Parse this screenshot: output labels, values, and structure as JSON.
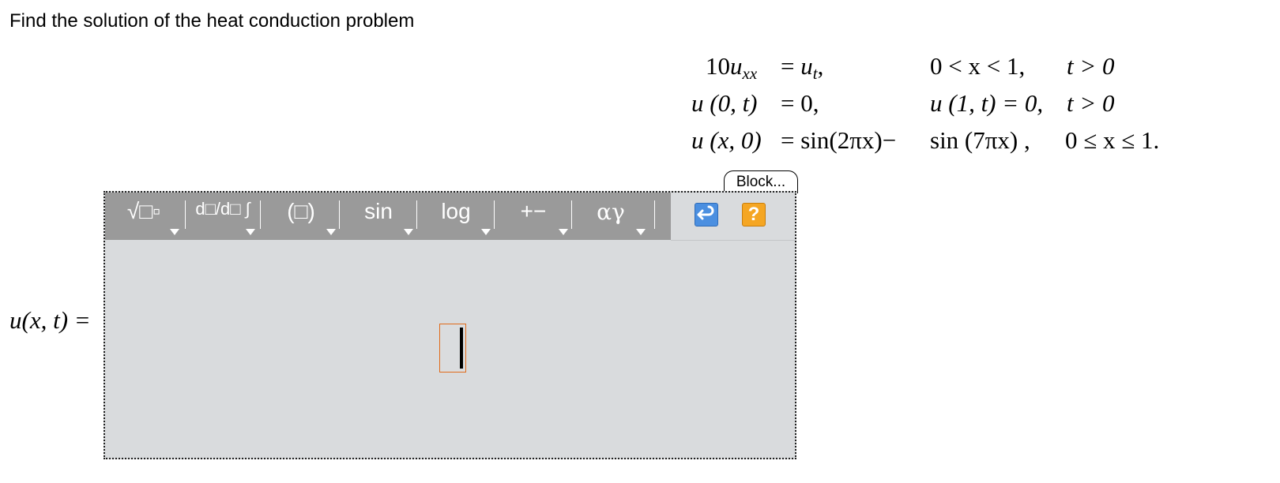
{
  "prompt": "Find the solution of the heat conduction problem",
  "equations": {
    "row1": {
      "lhs_coef": "10",
      "lhs_var": "u",
      "lhs_sub": "xx",
      "eq": "=",
      "rhs_var": "u",
      "rhs_sub": "t",
      "rhs_tail": ",",
      "cond1": "0 < x < 1,",
      "cond2": "t > 0"
    },
    "row2": {
      "lhs": "u (0, t)",
      "eq": "=",
      "rhs": "0,",
      "cond1": "u (1, t) = 0,",
      "cond2": "t > 0"
    },
    "row3": {
      "lhs": "u (x, 0)",
      "eq": "=",
      "rhs": "sin(2πx)−",
      "cond1": "sin (7πx) ,",
      "cond2": "0 ≤ x ≤ 1."
    }
  },
  "editor": {
    "block_tab": "Block...",
    "toolbar": {
      "templates": "√□▫",
      "calculus": "d□/d□ ∫",
      "brackets": "(□)",
      "trig": "sin",
      "log": "log",
      "operators": "+−",
      "greek": "αγ",
      "undo_icon": "undo-arrow-icon",
      "help": "?"
    },
    "accent_orange": "#f5a623",
    "accent_blue": "#4b8fe0",
    "toolbar_gray": "#9a9a9a"
  },
  "answer_label": "u(x, t) ="
}
